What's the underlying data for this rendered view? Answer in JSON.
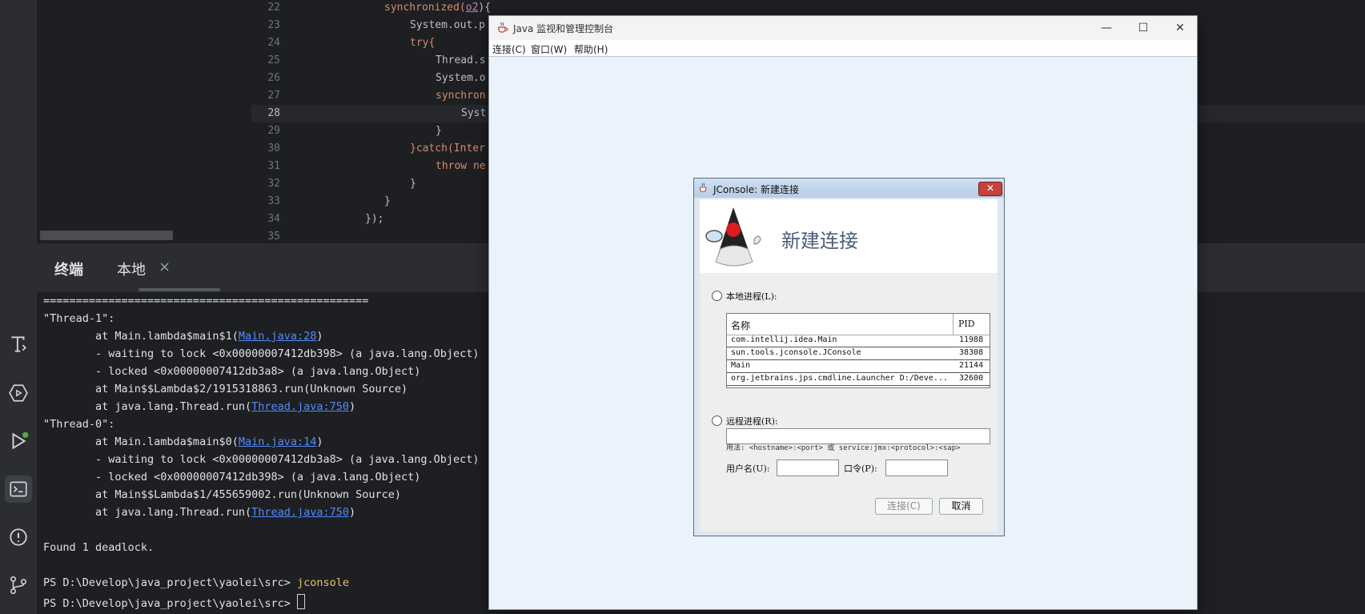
{
  "editor": {
    "lines": [
      {
        "num": "22",
        "html_parts": [
          "synchronized(",
          "o2",
          "){"
        ]
      },
      {
        "num": "23",
        "text": "System.out.p"
      },
      {
        "num": "24",
        "text": "try{"
      },
      {
        "num": "25",
        "text": "Thread.s"
      },
      {
        "num": "26",
        "text": "System.o"
      },
      {
        "num": "27",
        "text": "synchron"
      },
      {
        "num": "28",
        "text": "Syst"
      },
      {
        "num": "29",
        "text": "}"
      },
      {
        "num": "30",
        "text": "}catch(Inter"
      },
      {
        "num": "31",
        "text": "throw ne"
      },
      {
        "num": "32",
        "text": "}"
      },
      {
        "num": "33",
        "text": "}"
      },
      {
        "num": "34",
        "text": "});"
      },
      {
        "num": "35",
        "text": ""
      }
    ]
  },
  "toolwindow": {
    "tab_terminal": "终端",
    "tab_local": "本地",
    "close_glyph": "×"
  },
  "terminal": {
    "line_sep": "==================================================",
    "t1_header": "\"Thread-1\":",
    "t1_l1a": "        at Main.lambda$main$1(",
    "t1_l1_link": "Main.java:28",
    "t1_l1b": ")",
    "t1_l2": "        - waiting to lock <0x00000007412db398> (a java.lang.Object)",
    "t1_l3": "        - locked <0x00000007412db3a8> (a java.lang.Object)",
    "t1_l4": "        at Main$$Lambda$2/1915318863.run(Unknown Source)",
    "t1_l5a": "        at java.lang.Thread.run(",
    "t1_l5_link": "Thread.java:750",
    "t1_l5b": ")",
    "t0_header": "\"Thread-0\":",
    "t0_l1a": "        at Main.lambda$main$0(",
    "t0_l1_link": "Main.java:14",
    "t0_l1b": ")",
    "t0_l2": "        - waiting to lock <0x00000007412db3a8> (a java.lang.Object)",
    "t0_l3": "        - locked <0x00000007412db398> (a java.lang.Object)",
    "t0_l4": "        at Main$$Lambda$1/455659002.run(Unknown Source)",
    "t0_l5a": "        at java.lang.Thread.run(",
    "t0_l5_link": "Thread.java:750",
    "t0_l5b": ")",
    "found": "Found 1 deadlock.",
    "prompt1": "PS D:\\Develop\\java_project\\yaolei\\src> ",
    "cmd1": "jconsole",
    "prompt2": "PS D:\\Develop\\java_project\\yaolei\\src> "
  },
  "jconsole_window": {
    "title": "Java 监视和管理控制台",
    "menu": [
      "连接(C)",
      "窗口(W)",
      "帮助(H)"
    ],
    "min_glyph": "—",
    "max_glyph": "☐",
    "close_glyph": "✕"
  },
  "dialog": {
    "title": "JConsole: 新建连接",
    "close_glyph": "✕",
    "banner_title": "新建连接",
    "local_label": "本地进程(L):",
    "col_name": "名称",
    "col_pid": "PID",
    "processes": [
      {
        "name": "com.intellij.idea.Main",
        "pid": "11988"
      },
      {
        "name": "sun.tools.jconsole.JConsole",
        "pid": "38308"
      },
      {
        "name": "Main",
        "pid": "21144"
      },
      {
        "name": "org.jetbrains.jps.cmdline.Launcher D:/Deve...",
        "pid": "32600"
      }
    ],
    "remote_label": "远程进程(R):",
    "remote_value": "",
    "usage": "用法: <hostname>:<port> 或 service:jmx:<protocol>:<sap>",
    "username_label": "用户名(U):",
    "password_label": "口令(P):",
    "connect_label": "连接(C)",
    "cancel_label": "取消"
  },
  "colors": {
    "accent_link": "#548af7",
    "prompt_cmd": "#e8c45a",
    "keyword": "#cf8e6d"
  }
}
